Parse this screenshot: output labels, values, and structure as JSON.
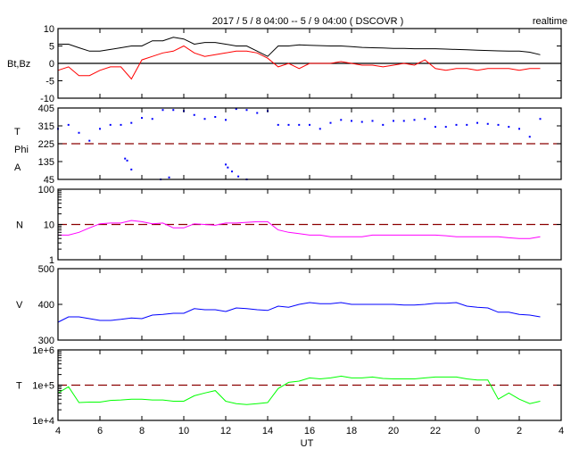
{
  "chart_data": {
    "type": "line",
    "title": "2017 / 5 / 8  04:00 -- 5 / 9  04:00 ( DSCOVR )",
    "badge": "realtime",
    "xlabel": "UT",
    "xlim": [
      4,
      28
    ],
    "x_ticks": [
      4,
      6,
      8,
      10,
      12,
      14,
      16,
      18,
      20,
      22,
      24,
      26,
      28
    ],
    "x_tick_labels": [
      "4",
      "6",
      "8",
      "10",
      "12",
      "14",
      "16",
      "18",
      "20",
      "22",
      "0",
      "2",
      "4"
    ],
    "x_step": 0.5,
    "x_start": 4,
    "panels": [
      {
        "label": "Bt,Bz",
        "scale": "linear",
        "ylim": [
          -10,
          10
        ],
        "ticks": [
          10,
          5,
          0,
          -5,
          -10
        ],
        "tick_labels": [
          "10",
          "5",
          "0",
          "-5",
          "-10"
        ],
        "reference": {
          "value": 0,
          "style": "solid",
          "color": "#000000"
        },
        "series": [
          {
            "name": "Bt",
            "color": "#000000",
            "mode": "line",
            "values": [
              5.5,
              5.5,
              4.5,
              3.5,
              3.5,
              4,
              4.5,
              5,
              5,
              6.5,
              6.5,
              7.5,
              7,
              5.5,
              6,
              6,
              5.5,
              5,
              5,
              3.5,
              2,
              5,
              5,
              5.3,
              5.2,
              5.1,
              5,
              5,
              4.8,
              4.6,
              4.5,
              4.4,
              4.3,
              4.3,
              4.2,
              4.2,
              4.2,
              4.1,
              4,
              3.9,
              3.8,
              3.7,
              3.6,
              3.5,
              3.5,
              3.2,
              2.5
            ]
          },
          {
            "name": "Bz",
            "color": "#ff0000",
            "mode": "line",
            "values": [
              -2,
              -1,
              -3.5,
              -3.5,
              -2,
              -1,
              -1,
              -4.5,
              1,
              2,
              3,
              3.5,
              5,
              3,
              2,
              2.5,
              3,
              3.5,
              3.5,
              3,
              1.5,
              -1,
              0,
              -1.5,
              0,
              0,
              0,
              0.5,
              0,
              -0.5,
              -0.5,
              -1,
              -0.5,
              0,
              -0.5,
              1,
              -1.5,
              -2,
              -1.5,
              -1.5,
              -2,
              -1.5,
              -1.5,
              -1.5,
              -2,
              -1.5,
              -1.5
            ]
          }
        ]
      },
      {
        "label": "T\nPhi\nA",
        "label_lines": [
          "T",
          "Phi",
          "A"
        ],
        "scale": "linear",
        "ylim": [
          45,
          405
        ],
        "ticks": [
          405,
          315,
          225,
          135,
          45
        ],
        "tick_labels": [
          "405",
          "315",
          "225",
          "135",
          "45"
        ],
        "reference": {
          "value": 225,
          "style": "dashed",
          "color": "#8b0000"
        },
        "series": [
          {
            "name": "Phi",
            "color": "#0000ff",
            "mode": "scatter",
            "values": [
              300,
              320,
              280,
              240,
              300,
              320,
              320,
              330,
              355,
              350,
              395,
              395,
              390,
              370,
              350,
              360,
              345,
              400,
              395,
              380,
              390,
              320,
              320,
              320,
              320,
              300,
              330,
              345,
              340,
              335,
              340,
              320,
              340,
              340,
              345,
              350,
              310,
              310,
              320,
              320,
              330,
              325,
              320,
              310,
              300,
              260,
              350
            ],
            "extra_points": [
              [
                7.2,
                150
              ],
              [
                7.3,
                140
              ],
              [
                7.5,
                95
              ],
              [
                8.9,
                45
              ],
              [
                9.3,
                55
              ],
              [
                12.0,
                120
              ],
              [
                12.1,
                105
              ],
              [
                12.3,
                85
              ],
              [
                12.6,
                60
              ],
              [
                13.0,
                45
              ]
            ]
          }
        ]
      },
      {
        "label": "N",
        "scale": "log",
        "ylim": [
          1,
          100
        ],
        "ticks": [
          100,
          10,
          1
        ],
        "tick_labels": [
          "100",
          "10",
          "1"
        ],
        "reference": {
          "value": 10,
          "style": "dashed",
          "color": "#8b0000"
        },
        "series": [
          {
            "name": "N",
            "color": "#ff00ff",
            "mode": "line",
            "values": [
              5,
              5,
              6,
              8,
              10.5,
              11,
              11,
              13,
              12,
              10.5,
              11,
              8,
              8,
              10.5,
              10,
              9.5,
              11,
              11,
              11.5,
              12,
              12,
              7,
              6,
              5.5,
              5,
              5,
              4.5,
              4.5,
              4.5,
              4.5,
              5,
              5,
              5,
              5,
              5,
              5,
              5,
              4.8,
              4.5,
              4.5,
              4.5,
              4.5,
              4.5,
              4.2,
              4,
              4,
              4.5
            ]
          }
        ]
      },
      {
        "label": "V",
        "scale": "linear",
        "ylim": [
          300,
          500
        ],
        "ticks": [
          500,
          400,
          300
        ],
        "tick_labels": [
          "500",
          "400",
          "300"
        ],
        "series": [
          {
            "name": "V",
            "color": "#0000ff",
            "mode": "line",
            "values": [
              350,
              365,
              365,
              360,
              355,
              355,
              358,
              362,
              360,
              370,
              372,
              375,
              375,
              388,
              385,
              385,
              380,
              390,
              388,
              385,
              383,
              395,
              392,
              400,
              405,
              402,
              402,
              405,
              400,
              400,
              400,
              400,
              400,
              398,
              398,
              400,
              403,
              403,
              405,
              395,
              392,
              390,
              378,
              378,
              372,
              370,
              365
            ]
          }
        ]
      },
      {
        "label": "T",
        "scale": "log",
        "ylim": [
          10000,
          1000000
        ],
        "ticks": [
          1000000,
          100000,
          10000
        ],
        "tick_labels": [
          "1e+6",
          "1e+5",
          "1e+4"
        ],
        "reference": {
          "value": 100000,
          "style": "dashed",
          "color": "#8b0000"
        },
        "series": [
          {
            "name": "T",
            "color": "#00ff00",
            "mode": "line",
            "values": [
              60000,
              90000,
              32000,
              33000,
              33000,
              37000,
              38000,
              40000,
              40000,
              38000,
              38000,
              35000,
              35000,
              50000,
              60000,
              70000,
              35000,
              30000,
              28000,
              30000,
              32000,
              80000,
              120000,
              130000,
              160000,
              150000,
              160000,
              180000,
              160000,
              160000,
              170000,
              155000,
              150000,
              150000,
              150000,
              160000,
              170000,
              170000,
              170000,
              150000,
              140000,
              140000,
              40000,
              60000,
              40000,
              30000,
              35000
            ]
          }
        ]
      }
    ]
  }
}
